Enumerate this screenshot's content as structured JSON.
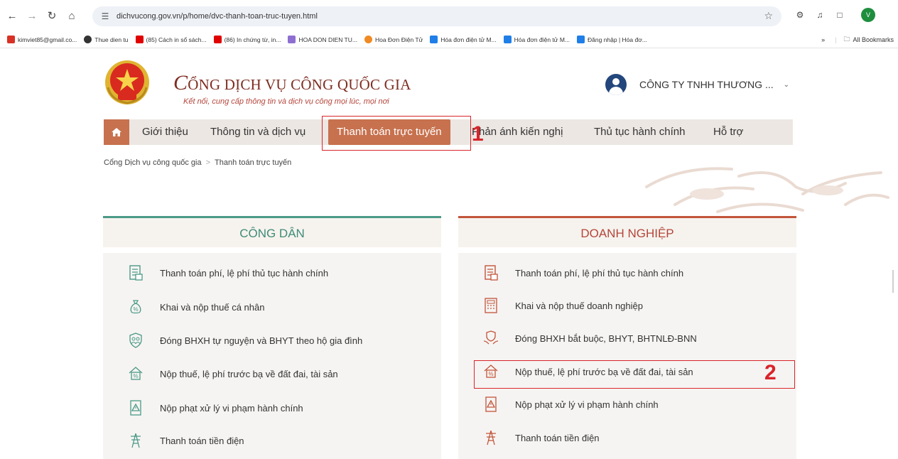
{
  "browser": {
    "url": "dichvucong.gov.vn/p/home/dvc-thanh-toan-truc-tuyen.html",
    "bookmarks": [
      {
        "label": "kimviet85@gmail.co...",
        "color": "#d93025"
      },
      {
        "label": "Thue dien tu",
        "color": "#333333"
      },
      {
        "label": "(85) Cách in sổ sách...",
        "color": "#e00000"
      },
      {
        "label": "(86) In chứng từ, in...",
        "color": "#e00000"
      },
      {
        "label": "HOA DON DIEN TU...",
        "color": "#8e6fd1"
      },
      {
        "label": "Hoa Đơn Điện Tử",
        "color": "#f08a24"
      },
      {
        "label": "Hóa đơn điện tử M...",
        "color": "#1f7ee8"
      },
      {
        "label": "Hóa đơn điện tử M...",
        "color": "#1f7ee8"
      },
      {
        "label": "Đăng nhập | Hóa đơ...",
        "color": "#1f7ee8"
      }
    ],
    "overflow_label": "»",
    "all_bookmarks_label": "All Bookmarks"
  },
  "site": {
    "title_initial": "C",
    "title_rest": "ỔNG DỊCH VỤ CÔNG QUỐC GIA",
    "subtitle": "Kết nối, cung cấp thông tin và dịch vụ công mọi lúc, mọi nơi",
    "account_name": "CÔNG TY TNHH THƯƠNG ..."
  },
  "nav": {
    "items": [
      "Giới thiệu",
      "Thông tin và dịch vụ",
      "Thanh toán trực tuyến",
      "Phản ánh kiến nghị",
      "Thủ tục hành chính",
      "Hỗ trợ"
    ],
    "active_index": 2
  },
  "breadcrumb": {
    "home": "Cổng Dịch vụ công quốc gia",
    "separator": ">",
    "current": "Thanh toán trực tuyến"
  },
  "markers": {
    "step1": "1",
    "step2": "2"
  },
  "citizen": {
    "heading": "CÔNG DÂN",
    "services": [
      {
        "label": "Thanh toán phí, lệ phí thủ tục hành chính",
        "icon": "document-fee-icon"
      },
      {
        "label": "Khai và nộp thuế cá nhân",
        "icon": "money-bag-icon"
      },
      {
        "label": "Đóng BHXH tự nguyện và BHYT theo hộ gia đình",
        "icon": "family-shield-icon"
      },
      {
        "label": "Nộp thuế, lệ phí trước bạ về đất đai, tài sản",
        "icon": "house-percent-icon"
      },
      {
        "label": "Nộp phạt xử lý vi phạm hành chính",
        "icon": "warning-document-icon"
      },
      {
        "label": "Thanh toán tiền điện",
        "icon": "power-tower-icon"
      }
    ]
  },
  "business": {
    "heading": "DOANH NGHIỆP",
    "services": [
      {
        "label": "Thanh toán phí, lệ phí thủ tục hành chính",
        "icon": "document-fee-icon"
      },
      {
        "label": "Khai và nộp thuế doanh nghiệp",
        "icon": "calculator-document-icon"
      },
      {
        "label": "Đóng BHXH bắt buộc, BHYT, BHTNLĐ-BNN",
        "icon": "hands-shield-icon"
      },
      {
        "label": "Nộp thuế, lệ phí trước bạ về đất đai, tài sản",
        "icon": "house-percent-icon"
      },
      {
        "label": "Nộp phạt xử lý vi phạm hành chính",
        "icon": "warning-document-icon"
      },
      {
        "label": "Thanh toán tiền điện",
        "icon": "power-tower-icon"
      }
    ]
  },
  "colors": {
    "accent": "#c7714e",
    "citizen": "#4b9a88",
    "business": "#c2553a",
    "highlight": "#d9242a"
  }
}
